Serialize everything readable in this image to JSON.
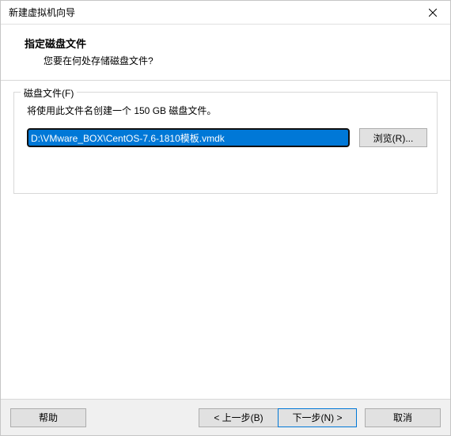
{
  "window": {
    "title": "新建虚拟机向导"
  },
  "header": {
    "title": "指定磁盘文件",
    "subtitle": "您要在何处存储磁盘文件?"
  },
  "group": {
    "label": "磁盘文件(F)",
    "description": "将使用此文件名创建一个 150 GB 磁盘文件。",
    "path_value": "D:\\VMware_BOX\\CentOS-7.6-1810模板.vmdk",
    "browse_label": "浏览(R)..."
  },
  "footer": {
    "help": "帮助",
    "back": "< 上一步(B)",
    "next": "下一步(N) >",
    "cancel": "取消"
  }
}
